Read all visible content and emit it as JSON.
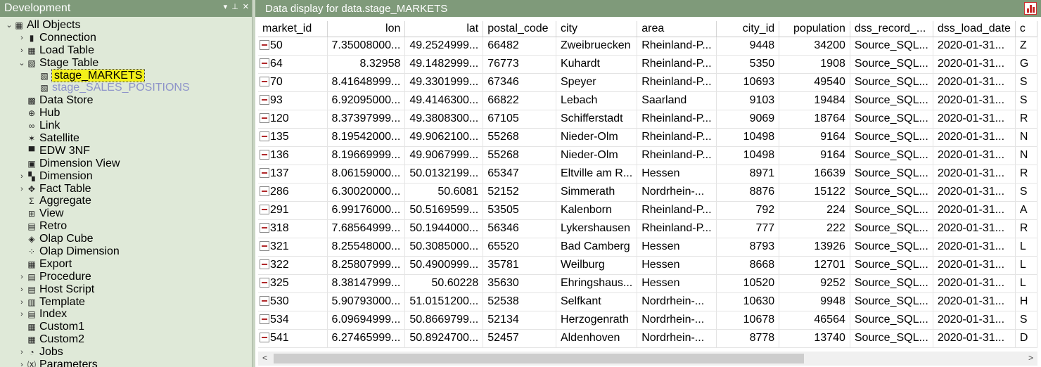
{
  "left_pane": {
    "title": "Development",
    "ctrl_dropdown": "▾",
    "ctrl_pin": "⊥",
    "ctrl_close": "✕",
    "tree": [
      {
        "label": "All Objects",
        "level": 0,
        "expand": "v",
        "icon": "folder-icon"
      },
      {
        "label": "Connection",
        "level": 1,
        "expand": ">",
        "icon": "database-icon"
      },
      {
        "label": "Load Table",
        "level": 1,
        "expand": ">",
        "icon": "load-table-icon"
      },
      {
        "label": "Stage Table",
        "level": 1,
        "expand": "v",
        "icon": "stage-table-icon"
      },
      {
        "label": "stage_MARKETS",
        "level": 2,
        "expand": "",
        "icon": "stage-object-icon",
        "selected": true
      },
      {
        "label": "stage_SALES_POSITIONS",
        "level": 2,
        "expand": "",
        "icon": "stage-object-icon",
        "faded": true
      },
      {
        "label": "Data Store",
        "level": 1,
        "expand": "",
        "icon": "data-store-icon"
      },
      {
        "label": "Hub",
        "level": 1,
        "expand": "",
        "icon": "hub-icon"
      },
      {
        "label": "Link",
        "level": 1,
        "expand": "",
        "icon": "link-icon"
      },
      {
        "label": "Satellite",
        "level": 1,
        "expand": "",
        "icon": "satellite-icon"
      },
      {
        "label": "EDW 3NF",
        "level": 1,
        "expand": "",
        "icon": "edw-icon"
      },
      {
        "label": "Dimension View",
        "level": 1,
        "expand": "",
        "icon": "dimension-view-icon"
      },
      {
        "label": "Dimension",
        "level": 1,
        "expand": ">",
        "icon": "dimension-icon"
      },
      {
        "label": "Fact Table",
        "level": 1,
        "expand": ">",
        "icon": "fact-table-icon"
      },
      {
        "label": "Aggregate",
        "level": 1,
        "expand": "",
        "icon": "sigma-icon"
      },
      {
        "label": "View",
        "level": 1,
        "expand": "",
        "icon": "view-icon"
      },
      {
        "label": "Retro",
        "level": 1,
        "expand": "",
        "icon": "retro-icon"
      },
      {
        "label": "Olap Cube",
        "level": 1,
        "expand": "",
        "icon": "cube-icon"
      },
      {
        "label": "Olap Dimension",
        "level": 1,
        "expand": "",
        "icon": "olap-dimension-icon"
      },
      {
        "label": "Export",
        "level": 1,
        "expand": "",
        "icon": "export-icon"
      },
      {
        "label": "Procedure",
        "level": 1,
        "expand": ">",
        "icon": "procedure-icon"
      },
      {
        "label": "Host Script",
        "level": 1,
        "expand": ">",
        "icon": "host-script-icon"
      },
      {
        "label": "Template",
        "level": 1,
        "expand": ">",
        "icon": "template-icon"
      },
      {
        "label": "Index",
        "level": 1,
        "expand": ">",
        "icon": "index-icon"
      },
      {
        "label": "Custom1",
        "level": 1,
        "expand": "",
        "icon": "grid-icon"
      },
      {
        "label": "Custom2",
        "level": 1,
        "expand": "",
        "icon": "grid-icon"
      },
      {
        "label": "Jobs",
        "level": 1,
        "expand": ">",
        "icon": "clock-icon"
      },
      {
        "label": "Parameters",
        "level": 1,
        "expand": ">",
        "icon": "parameters-icon"
      }
    ]
  },
  "right_pane": {
    "title": "Data display for data.stage_MARKETS",
    "columns": [
      {
        "label": "market_id",
        "align": "left"
      },
      {
        "label": "lon",
        "align": "right"
      },
      {
        "label": "lat",
        "align": "right"
      },
      {
        "label": "postal_code",
        "align": "left"
      },
      {
        "label": "city",
        "align": "left"
      },
      {
        "label": "area",
        "align": "left"
      },
      {
        "label": "city_id",
        "align": "right"
      },
      {
        "label": "population",
        "align": "right"
      },
      {
        "label": "dss_record_...",
        "align": "left"
      },
      {
        "label": "dss_load_date",
        "align": "left"
      },
      {
        "label": "c",
        "align": "left"
      }
    ],
    "rows": [
      [
        "50",
        "7.35008000...",
        "49.2524999...",
        "66482",
        "Zweibruecken",
        "Rheinland-P...",
        "9448",
        "34200",
        "Source_SQL...",
        "2020-01-31...",
        "Z"
      ],
      [
        "64",
        "8.32958",
        "49.1482999...",
        "76773",
        "Kuhardt",
        "Rheinland-P...",
        "5350",
        "1908",
        "Source_SQL...",
        "2020-01-31...",
        "G"
      ],
      [
        "70",
        "8.41648999...",
        "49.3301999...",
        "67346",
        "Speyer",
        "Rheinland-P...",
        "10693",
        "49540",
        "Source_SQL...",
        "2020-01-31...",
        "S"
      ],
      [
        "93",
        "6.92095000...",
        "49.4146300...",
        "66822",
        "Lebach",
        "Saarland",
        "9103",
        "19484",
        "Source_SQL...",
        "2020-01-31...",
        "S"
      ],
      [
        "120",
        "8.37397999...",
        "49.3808300...",
        "67105",
        "Schifferstadt",
        "Rheinland-P...",
        "9069",
        "18764",
        "Source_SQL...",
        "2020-01-31...",
        "R"
      ],
      [
        "135",
        "8.19542000...",
        "49.9062100...",
        "55268",
        "Nieder-Olm",
        "Rheinland-P...",
        "10498",
        "9164",
        "Source_SQL...",
        "2020-01-31...",
        "N"
      ],
      [
        "136",
        "8.19669999...",
        "49.9067999...",
        "55268",
        "Nieder-Olm",
        "Rheinland-P...",
        "10498",
        "9164",
        "Source_SQL...",
        "2020-01-31...",
        "N"
      ],
      [
        "137",
        "8.06159000...",
        "50.0132199...",
        "65347",
        "Eltville am R...",
        "Hessen",
        "8971",
        "16639",
        "Source_SQL...",
        "2020-01-31...",
        "R"
      ],
      [
        "286",
        "6.30020000...",
        "50.6081",
        "52152",
        "Simmerath",
        "Nordrhein-...",
        "8876",
        "15122",
        "Source_SQL...",
        "2020-01-31...",
        "S"
      ],
      [
        "291",
        "6.99176000...",
        "50.5169599...",
        "53505",
        "Kalenborn",
        "Rheinland-P...",
        "792",
        "224",
        "Source_SQL...",
        "2020-01-31...",
        "A"
      ],
      [
        "318",
        "7.68564999...",
        "50.1944000...",
        "56346",
        "Lykershausen",
        "Rheinland-P...",
        "777",
        "222",
        "Source_SQL...",
        "2020-01-31...",
        "R"
      ],
      [
        "321",
        "8.25548000...",
        "50.3085000...",
        "65520",
        "Bad Camberg",
        "Hessen",
        "8793",
        "13926",
        "Source_SQL...",
        "2020-01-31...",
        "L"
      ],
      [
        "322",
        "8.25807999...",
        "50.4900999...",
        "35781",
        "Weilburg",
        "Hessen",
        "8668",
        "12701",
        "Source_SQL...",
        "2020-01-31...",
        "L"
      ],
      [
        "325",
        "8.38147999...",
        "50.60228",
        "35630",
        "Ehringshaus...",
        "Hessen",
        "10520",
        "9252",
        "Source_SQL...",
        "2020-01-31...",
        "L"
      ],
      [
        "530",
        "5.90793000...",
        "51.0151200...",
        "52538",
        "Selfkant",
        "Nordrhein-...",
        "10630",
        "9948",
        "Source_SQL...",
        "2020-01-31...",
        "H"
      ],
      [
        "534",
        "6.09694999...",
        "50.8669799...",
        "52134",
        "Herzogenrath",
        "Nordrhein-...",
        "10678",
        "46564",
        "Source_SQL...",
        "2020-01-31...",
        "S"
      ],
      [
        "541",
        "6.27465999...",
        "50.8924700...",
        "52457",
        "Aldenhoven",
        "Nordrhein-...",
        "8778",
        "13740",
        "Source_SQL...",
        "2020-01-31...",
        "D"
      ]
    ],
    "scroll_left": "<",
    "scroll_right": ">"
  }
}
